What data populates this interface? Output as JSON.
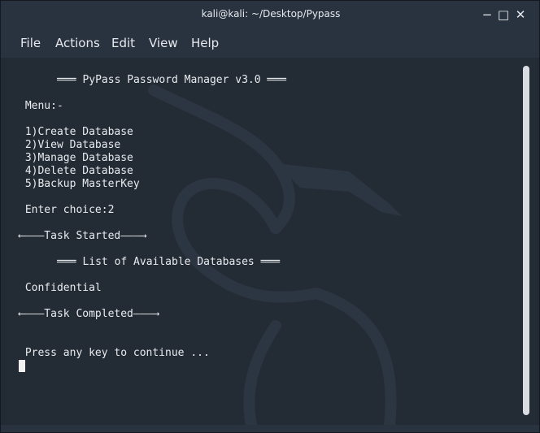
{
  "window": {
    "title": "kali@kali: ~/Desktop/Pypass",
    "controls": {
      "minimize": "−",
      "maximize": "□",
      "close": "✕"
    }
  },
  "menubar": {
    "items": [
      "File",
      "Actions",
      "Edit",
      "View",
      "Help"
    ]
  },
  "terminal": {
    "lines": [
      "     ═══ PyPass Password Manager v3.0 ═══",
      " Menu:-",
      " 1)Create Database",
      " 2)View Database",
      " 3)Manage Database",
      " 4)Delete Database",
      " 5)Backup MasterKey",
      " Enter choice:2",
      "⟵———Task Started———⟶",
      "     ═══ List of Available Databases ═══",
      " Confidential",
      "⟵———Task Completed———⟶",
      " Press any key to continue ..."
    ]
  },
  "colors": {
    "background": "#222b35",
    "text": "#e9ecef",
    "bar": "#293340"
  },
  "icons": {
    "watermark": "kali-dragon-icon"
  }
}
